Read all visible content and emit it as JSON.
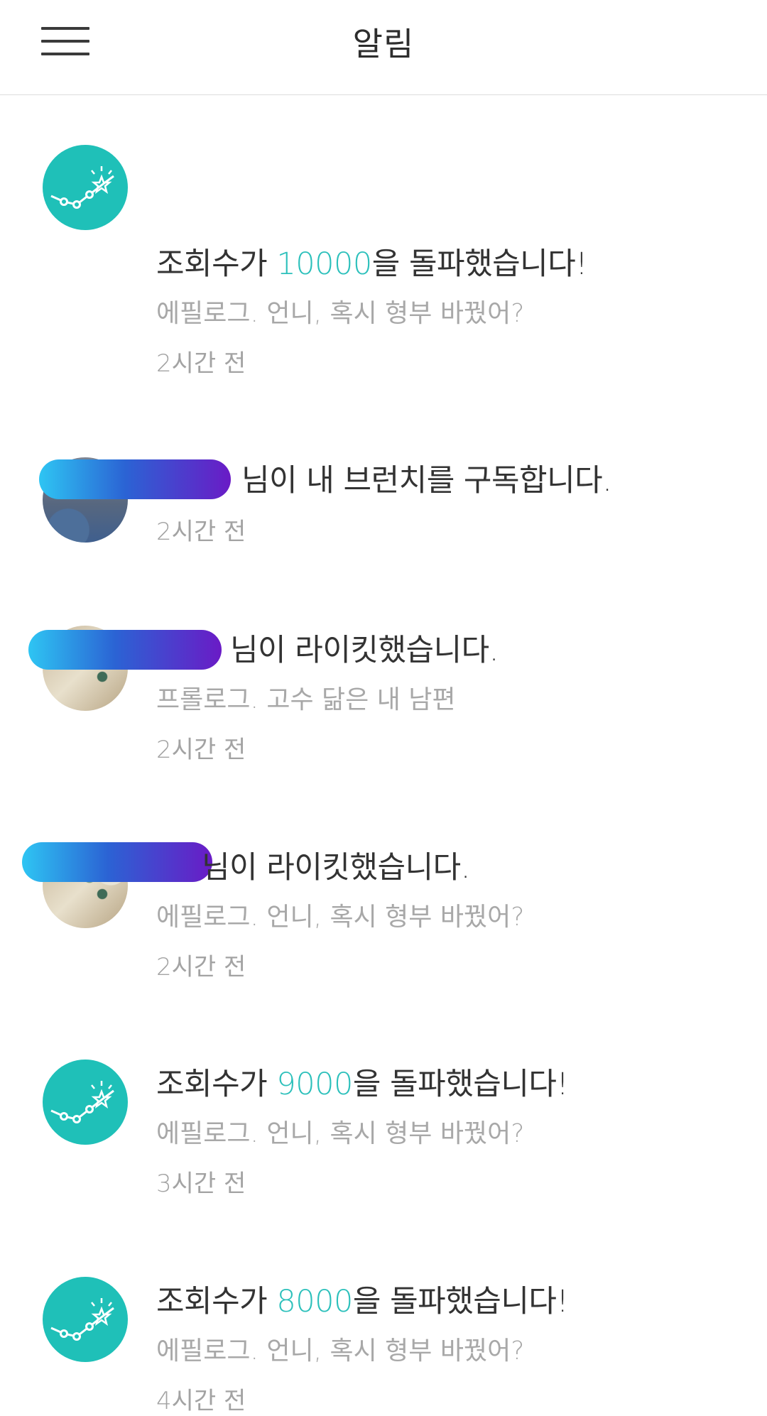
{
  "header": {
    "title": "알림",
    "menu_icon": "hamburger-menu-icon"
  },
  "colors": {
    "accent": "#2cc0bb",
    "stat_icon_bg": "#1fc0b8",
    "primary_text": "#333333",
    "secondary_text": "#a8a8a8"
  },
  "notifications": [
    {
      "type": "views-milestone",
      "icon": "trending-star-icon",
      "text_before": "조회수가 ",
      "count": "10000",
      "text_after": "을 돌파했습니다!",
      "post": "에필로그. 언니, 혹시 형부 바꿨어?",
      "time": "2시간 전"
    },
    {
      "type": "subscribe",
      "text": "님이 내 브런치를 구독합니다.",
      "time": "2시간 전"
    },
    {
      "type": "like",
      "text": "님이 라이킷했습니다.",
      "post": "프롤로그. 고수 닮은 내 남편",
      "time": "2시간 전"
    },
    {
      "type": "like",
      "text": "님이 라이킷했습니다.",
      "post": "에필로그. 언니, 혹시 형부 바꿨어?",
      "time": "2시간 전"
    },
    {
      "type": "views-milestone",
      "icon": "trending-star-icon",
      "text_before": "조회수가 ",
      "count": "9000",
      "text_after": "을 돌파했습니다!",
      "post": "에필로그. 언니, 혹시 형부 바꿨어?",
      "time": "3시간 전"
    },
    {
      "type": "views-milestone",
      "icon": "trending-star-icon",
      "text_before": "조회수가 ",
      "count": "8000",
      "text_after": "을 돌파했습니다!",
      "post": "에필로그. 언니, 혹시 형부 바꿨어?",
      "time": "4시간 전"
    }
  ]
}
